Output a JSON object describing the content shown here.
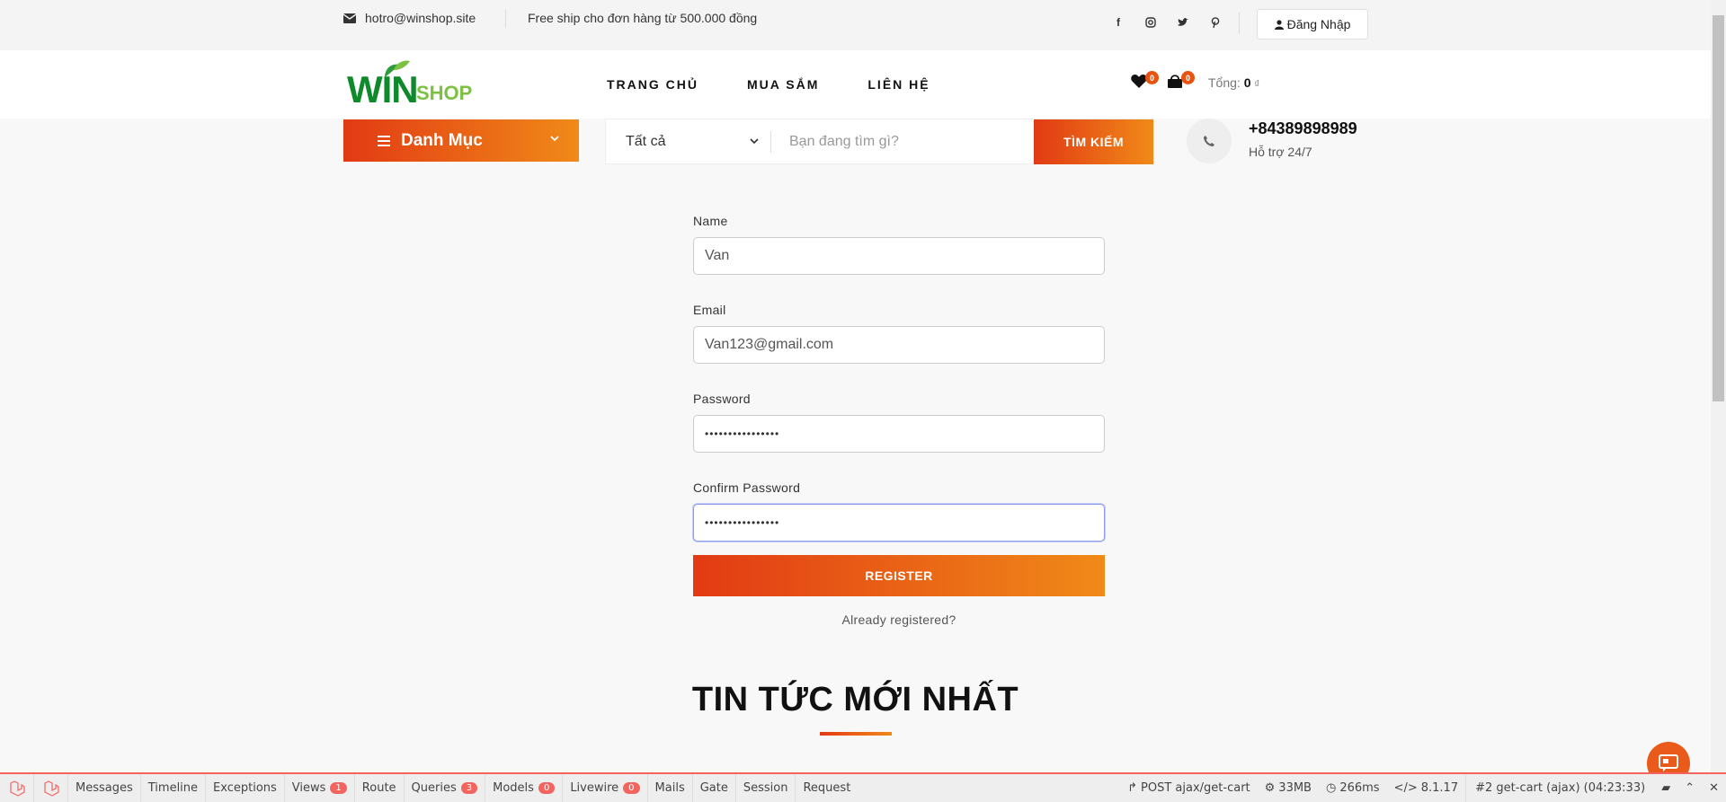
{
  "topbar": {
    "email": "hotro@winshop.site",
    "promo": "Free ship cho đơn hàng từ 500.000 đồng",
    "login_label": "Đăng Nhập"
  },
  "header": {
    "logo_win": "WIN",
    "logo_shop": "SHOP",
    "nav": [
      "TRANG CHỦ",
      "MUA SẮM",
      "LIÊN HỆ"
    ],
    "wishlist_count": "0",
    "cart_count": "0",
    "total_label": "Tổng:",
    "total_value": "0",
    "currency": "₫"
  },
  "search": {
    "category_button": "Danh Mục",
    "category_select": "Tất cả",
    "placeholder": "Bạn đang tìm gì?",
    "button": "TÌM KIẾM",
    "phone": "+84389898989",
    "support": "Hỗ trợ 24/7"
  },
  "form": {
    "name_label": "Name",
    "name_value": "Van",
    "email_label": "Email",
    "email_value": "Van123@gmail.com",
    "password_label": "Password",
    "password_value": "••••••••••••••••",
    "confirm_label": "Confirm Password",
    "confirm_value": "••••••••••••••••",
    "register_button": "REGISTER",
    "already_link": "Already registered?"
  },
  "news": {
    "title": "TIN TỨC MỚI NHẤT"
  },
  "debugbar": {
    "tabs": [
      {
        "label": "Messages"
      },
      {
        "label": "Timeline"
      },
      {
        "label": "Exceptions"
      },
      {
        "label": "Views",
        "count": "1"
      },
      {
        "label": "Route"
      },
      {
        "label": "Queries",
        "count": "3"
      },
      {
        "label": "Models",
        "count": "0"
      },
      {
        "label": "Livewire",
        "count": "0"
      },
      {
        "label": "Mails"
      },
      {
        "label": "Gate"
      },
      {
        "label": "Session"
      },
      {
        "label": "Request"
      }
    ],
    "request": "POST ajax/get-cart",
    "memory": "33MB",
    "time": "266ms",
    "php": "8.1.17",
    "current_request": "#2 get-cart (ajax) (04:23:33)"
  },
  "colors": {
    "accent_start": "#e23a14",
    "accent_end": "#f08a18",
    "logo_green": "#0e8a2c",
    "logo_light_green": "#7cc142",
    "debug_red": "#f4645f"
  }
}
